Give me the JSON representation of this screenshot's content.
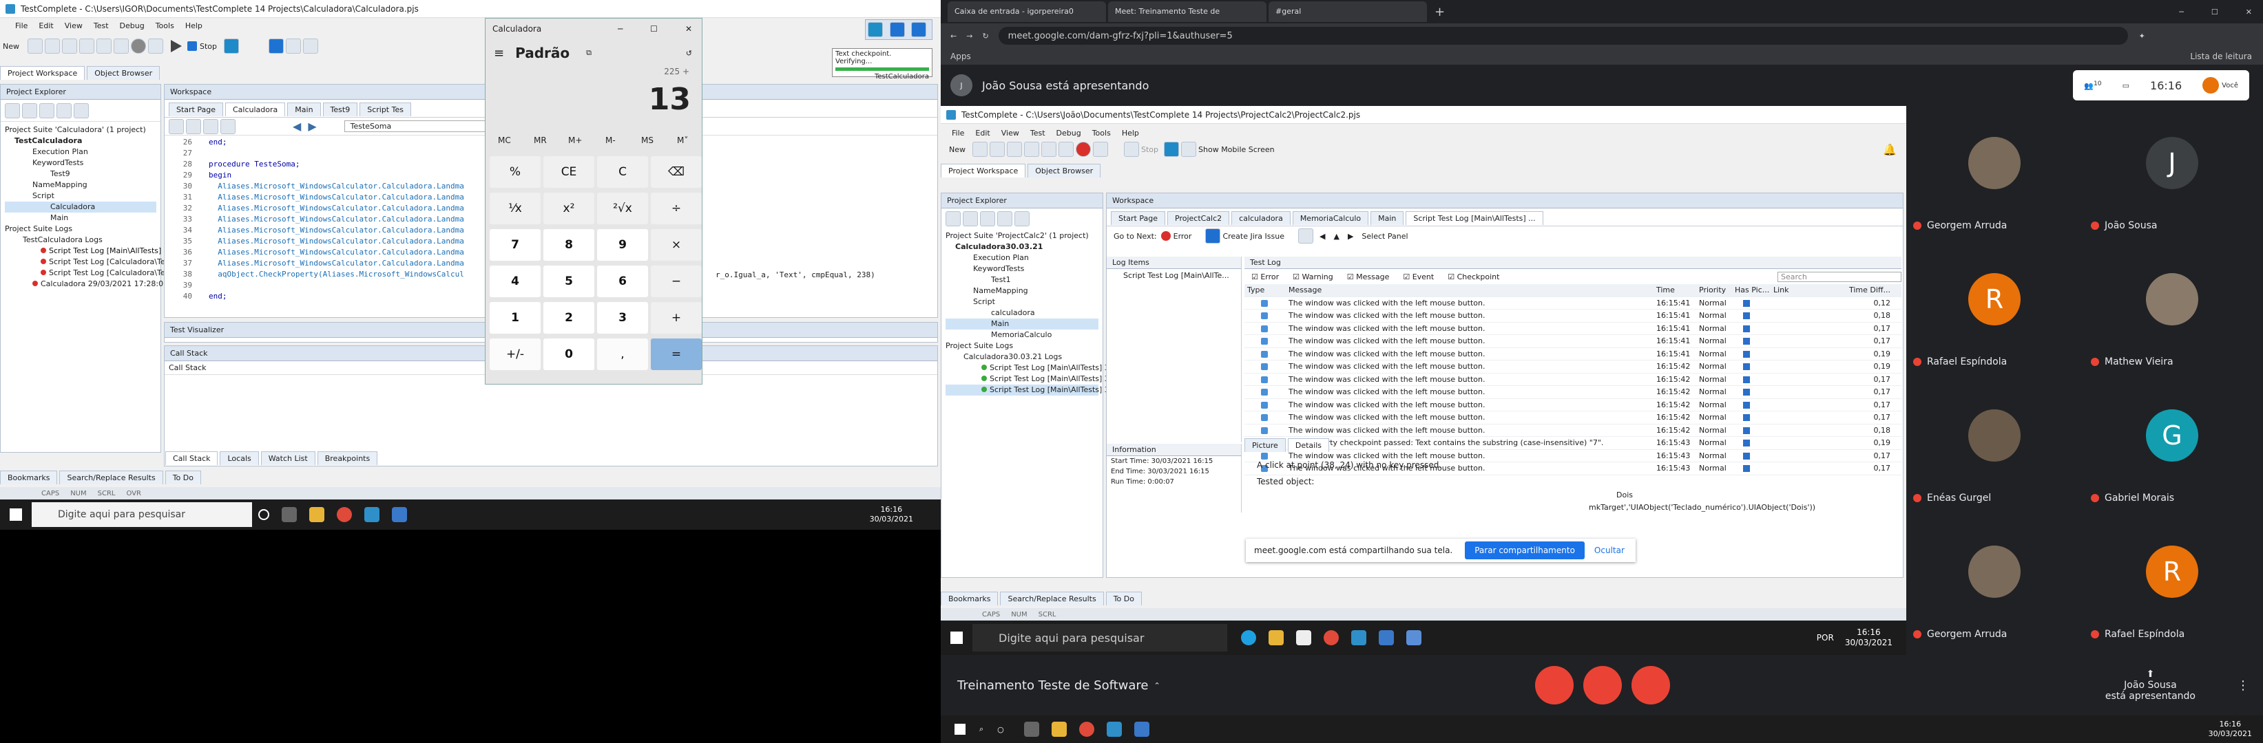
{
  "left": {
    "titlebar": "TestComplete - C:\\Users\\IGOR\\Documents\\TestComplete 14 Projects\\Calculadora\\Calculadora.pjs",
    "menu": [
      "File",
      "Edit",
      "View",
      "Test",
      "Debug",
      "Tools",
      "Help"
    ],
    "toolbar": {
      "new": "New",
      "stop": "Stop"
    },
    "tabs_top": [
      "Project Workspace",
      "Object Browser"
    ],
    "explorer_title": "Project Explorer",
    "tree": [
      "Project Suite 'Calculadora' (1 project)",
      "TestCalculadora",
      "Execution Plan",
      "KeywordTests",
      "Test9",
      "NameMapping",
      "Script",
      "Calculadora",
      "Main",
      "Project Suite Logs",
      "TestCalculadora Logs",
      "Script Test Log [Main\\AllTests] 3",
      "Script Test Log [Calculadora\\Tes",
      "Script Test Log [Calculadora\\Tes",
      "Calculadora 29/03/2021 17:28:01"
    ],
    "workspace_title": "Workspace",
    "doc_tabs": [
      "Start Page",
      "Calculadora",
      "Main",
      "Test9",
      "Script Tes"
    ],
    "routine": "TesteSoma",
    "code_lines": [
      {
        "n": "26",
        "t": "end;"
      },
      {
        "n": "27",
        "t": ""
      },
      {
        "n": "28",
        "t": "procedure TesteSoma;"
      },
      {
        "n": "29",
        "t": "begin"
      },
      {
        "n": "30",
        "t": "  Aliases.Microsoft_WindowsCalculator.Calculadora.Landma"
      },
      {
        "n": "31",
        "t": "  Aliases.Microsoft_WindowsCalculator.Calculadora.Landma"
      },
      {
        "n": "32",
        "t": "  Aliases.Microsoft_WindowsCalculator.Calculadora.Landma"
      },
      {
        "n": "33",
        "t": "  Aliases.Microsoft_WindowsCalculator.Calculadora.Landma"
      },
      {
        "n": "34",
        "t": "  Aliases.Microsoft_WindowsCalculator.Calculadora.Landma"
      },
      {
        "n": "35",
        "t": "  Aliases.Microsoft_WindowsCalculator.Calculadora.Landma"
      },
      {
        "n": "36",
        "t": "  Aliases.Microsoft_WindowsCalculator.Calculadora.Landma"
      },
      {
        "n": "37",
        "t": "  Aliases.Microsoft_WindowsCalculator.Calculadora.Landma"
      },
      {
        "n": "38",
        "t": "  aqObject.CheckProperty(Aliases.Microsoft_WindowsCalcul"
      },
      {
        "n": "39",
        "t": ""
      },
      {
        "n": "40",
        "t": "end;"
      }
    ],
    "code_tail": "r_o.Igual_a, 'Text', cmpEqual, 238)",
    "test_visualizer": "Test Visualizer",
    "call_stack": "Call Stack",
    "call_stack_col": "Call Stack",
    "bottom_tabs": [
      "Call Stack",
      "Locals",
      "Watch List",
      "Breakpoints"
    ],
    "bottom_tabs2": [
      "Bookmarks",
      "Search/Replace Results",
      "To Do"
    ],
    "status": [
      "CAPS",
      "NUM",
      "SCRL",
      "OVR"
    ],
    "checkpoint_text": "Text checkpoint. Verifying...",
    "checkpoint_name": "TestCalculadora"
  },
  "calculator": {
    "title": "Calculadora",
    "mode": "Padrão",
    "expression": "225 +",
    "display": "13",
    "memory": [
      "MC",
      "MR",
      "M+",
      "M-",
      "MS",
      "M˅"
    ],
    "keys": [
      "%",
      "CE",
      "C",
      "⌫",
      "⅟x",
      "x²",
      "²√x",
      "÷",
      "7",
      "8",
      "9",
      "×",
      "4",
      "5",
      "6",
      "−",
      "1",
      "2",
      "3",
      "+",
      "+/-",
      "0",
      ",",
      "="
    ]
  },
  "taskbar_left": {
    "search": "Digite aqui para pesquisar",
    "time": "16:16",
    "date": "30/03/2021"
  },
  "browser": {
    "tabs": [
      "Caixa de entrada - igorpereira0",
      "Meet: Treinamento Teste de",
      "#geral"
    ],
    "url": "meet.google.com/dam-gfrz-fxj?pli=1&authuser=5",
    "apps": "Apps",
    "reading_list": "Lista de leitura",
    "presenter": "João Sousa está apresentando",
    "presenter_initial": "J",
    "clock": "16:16",
    "people_count": "10",
    "you_label": "Você"
  },
  "remote": {
    "titlebar": "TestComplete - C:\\Users\\João\\Documents\\TestComplete 14 Projects\\ProjectCalc2\\ProjectCalc2.pjs",
    "menu": [
      "File",
      "Edit",
      "View",
      "Test",
      "Debug",
      "Tools",
      "Help"
    ],
    "toolbar": {
      "new": "New",
      "stop": "Stop",
      "mobile": "Show Mobile Screen"
    },
    "tabs_top": [
      "Project Workspace",
      "Object Browser"
    ],
    "explorer_title": "Project Explorer",
    "tree": [
      "Project Suite 'ProjectCalc2' (1 project)",
      "Calculadora30.03.21",
      "Execution Plan",
      "KeywordTests",
      "Test1",
      "NameMapping",
      "Script",
      "calculadora",
      "Main",
      "MemoriaCalculo",
      "Project Suite Logs",
      "Calculadora30.03.21 Logs",
      "Script Test Log [Main\\AllTests] 3",
      "Script Test Log [Main\\AllTests] 3",
      "Script Test Log [Main\\AllTests] 3"
    ],
    "workspace_title": "Workspace",
    "doc_tabs": [
      "Start Page",
      "ProjectCalc2",
      "calculadora",
      "MemoriaCalculo",
      "Main",
      "Script Test Log [Main\\AllTests] ..."
    ],
    "goto_next": "Go to Next:",
    "error_label": "Error",
    "jira": "Create Jira Issue",
    "select_panel": "Select Panel",
    "log_items": "Log Items",
    "log_item": "Script Test Log [Main\\AllTe...",
    "information": "Information",
    "info_lines": [
      "Start Time: 30/03/2021 16:15",
      "End Time: 30/03/2021 16:15",
      "Run Time: 0:00:07"
    ],
    "test_log": "Test Log",
    "filters": [
      "Error",
      "Warning",
      "Message",
      "Event",
      "Checkpoint"
    ],
    "search": "Search",
    "columns": [
      "Type",
      "Message",
      "Time",
      "Priority",
      "Has Pic...",
      "Link",
      "Time Diff..."
    ],
    "rows": [
      {
        "m": "The window was clicked with the left mouse button.",
        "t": "16:15:41",
        "p": "Normal",
        "d": "0,12"
      },
      {
        "m": "The window was clicked with the left mouse button.",
        "t": "16:15:41",
        "p": "Normal",
        "d": "0,18"
      },
      {
        "m": "The window was clicked with the left mouse button.",
        "t": "16:15:41",
        "p": "Normal",
        "d": "0,17"
      },
      {
        "m": "The window was clicked with the left mouse button.",
        "t": "16:15:41",
        "p": "Normal",
        "d": "0,17"
      },
      {
        "m": "The window was clicked with the left mouse button.",
        "t": "16:15:41",
        "p": "Normal",
        "d": "0,19"
      },
      {
        "m": "The window was clicked with the left mouse button.",
        "t": "16:15:42",
        "p": "Normal",
        "d": "0,19"
      },
      {
        "m": "The window was clicked with the left mouse button.",
        "t": "16:15:42",
        "p": "Normal",
        "d": "0,17"
      },
      {
        "m": "The window was clicked with the left mouse button.",
        "t": "16:15:42",
        "p": "Normal",
        "d": "0,17"
      },
      {
        "m": "The window was clicked with the left mouse button.",
        "t": "16:15:42",
        "p": "Normal",
        "d": "0,17"
      },
      {
        "m": "The window was clicked with the left mouse button.",
        "t": "16:15:42",
        "p": "Normal",
        "d": "0,17"
      },
      {
        "m": "The window was clicked with the left mouse button.",
        "t": "16:15:42",
        "p": "Normal",
        "d": "0,18"
      },
      {
        "m": "The property checkpoint passed: Text contains the substring (case-insensitive) \"7\".",
        "t": "16:15:43",
        "p": "Normal",
        "d": "0,19"
      },
      {
        "m": "The window was clicked with the left mouse button.",
        "t": "16:15:43",
        "p": "Normal",
        "d": "0,17"
      },
      {
        "m": "The window was clicked with the left mouse button.",
        "t": "16:15:43",
        "p": "Normal",
        "d": "0,17"
      }
    ],
    "detail_tabs": [
      "Picture",
      "Details"
    ],
    "detail_text": "A click at point (38, 24) with no key pressed.",
    "tested_object": "Tested object:",
    "detail_tail": "Dois",
    "detail_tail2": "mkTarget','UIAObject('Teclado_numérico').UIAObject('Dois'))",
    "share_bar": "meet.google.com está compartilhando sua tela.",
    "stop_share": "Parar compartilhamento",
    "hide": "Ocultar",
    "bottom_tabs": [
      "Bookmarks",
      "Search/Replace Results",
      "To Do"
    ],
    "status": [
      "CAPS",
      "NUM",
      "SCRL"
    ],
    "taskbar": {
      "search": "Digite aqui para pesquisar",
      "lang": "POR",
      "time": "16:16",
      "date": "30/03/2021"
    }
  },
  "participants": [
    {
      "name": "Georgem Arruda",
      "initial": "",
      "color": "#7a6a5a"
    },
    {
      "name": "João Sousa",
      "initial": "J",
      "color": "#3c4043"
    },
    {
      "name": "Rafael Espíndola",
      "initial": "R",
      "color": "#e8710a"
    },
    {
      "name": "Mathew Vieira",
      "initial": "",
      "color": "#8a7a6a"
    },
    {
      "name": "Enéas Gurgel",
      "initial": "",
      "color": "#6a5a4a"
    },
    {
      "name": "Gabriel Morais",
      "initial": "G",
      "color": "#129eaf"
    },
    {
      "name": "Georgem Arruda",
      "initial": "",
      "color": "#7a6a5a"
    },
    {
      "name": "Rafael Espíndola",
      "initial": "R",
      "color": "#e8710a"
    }
  ],
  "meet_bottom": {
    "meeting": "Treinamento Teste de Software",
    "presenter1": "João Sousa",
    "presenter2": "está apresentando"
  },
  "taskbar_right": {
    "time": "16:16",
    "date": "30/03/2021"
  }
}
